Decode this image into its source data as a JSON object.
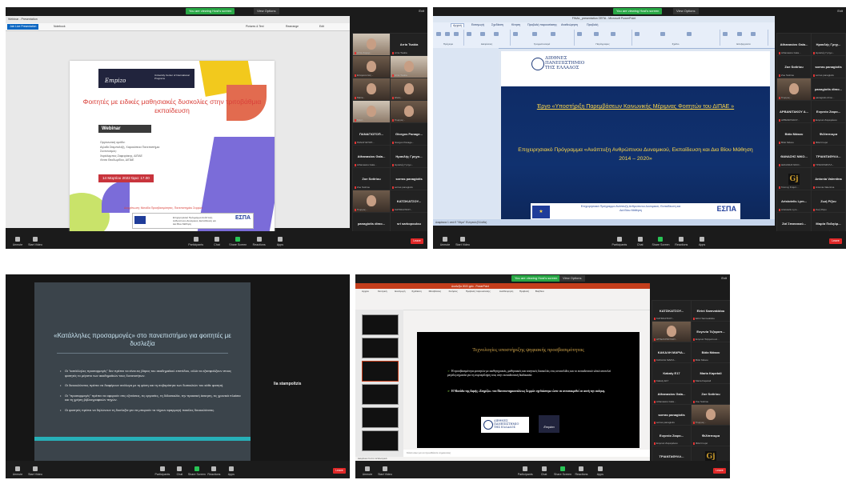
{
  "zoom": {
    "share_badge": "You are viewing Host's screen",
    "view_options": "View Options",
    "exit_label": "Exit",
    "controls": [
      "Unmute",
      "Start Video",
      "Participants",
      "Chat",
      "Share Screen",
      "Reactions",
      "Apps"
    ],
    "end_label": "Leave"
  },
  "panel1": {
    "browser_tab": "Webinar - Presentation",
    "toolbar": [
      "Join Live Presentation",
      "Notebook",
      "Pictures & Text",
      "Rearrange",
      "Edit"
    ],
    "slide": {
      "brand": "Empizo",
      "uni_text": "University Center of International Programs",
      "title": "Φοιτητές με ειδικές μαθησιακές δυσκολίες στην τριτοβάθμια εκπαίδευση",
      "webinar": "Webinar",
      "org_lines": [
        "Οργανωτική ομάδα:",
        "Αγλαΐα Σταμπολτζή, Χαροκόπειο Πανεπιστήμιο",
        "Συντονισμός:",
        "Χαράλαμπος Ζαφειράκης, ΔΙΠΑΕ",
        "Λίτσα Θεοδωρίδου, ΔΙΠΑΕ"
      ],
      "date": "14 Μαρτίου 2022  Ώρα: 17.00",
      "footer": "Διοργάνωση: Μονάδα Προσβασιμότητας, Πανεπιστημίου Σερρών",
      "espa_text": "Επιχειρησιακό Πρόγραμμα Ανάπτυξη Ανθρώπινου Δυναμικού, Εκπαίδευση και Δια Βίου Μάθηση",
      "espa": "ΕΣΠΑ"
    },
    "participants": [
      {
        "name": "",
        "sub": "Arria Ζαφειρ...",
        "photo": true
      },
      {
        "name": "Arria Tsakia",
        "sub": "Arria Tsakia",
        "photo": false
      },
      {
        "name": "",
        "sub": "Επαμινώντας...",
        "photo": true
      },
      {
        "name": "",
        "sub": "Arria Tsakia",
        "photo": true
      },
      {
        "name": "",
        "sub": "Maria...",
        "photo": true
      },
      {
        "name": "",
        "sub": "Ηλίας...",
        "photo": true
      },
      {
        "name": "",
        "sub": "Nikol...",
        "photo": true
      },
      {
        "name": "",
        "sub": "Γιώργος...",
        "photo": true
      },
      {
        "name": "ΠΑΝΑΓΙΩΤΟΠ...",
        "sub": "ΠΑΝΑΓΙΩΤΟΠ...",
        "photo": false
      },
      {
        "name": "Giorgos Panage...",
        "sub": "Giorgos Panage...",
        "photo": false
      },
      {
        "name": "Athanasios Gala...",
        "sub": "Athanasios Gala...",
        "photo": false
      },
      {
        "name": "Ηρακλής Γρηγο...",
        "sub": "Ηρακλής Γρηγο...",
        "photo": false
      },
      {
        "name": "Zoe Sotiriou",
        "sub": "Zoe Sotiriou",
        "photo": false
      },
      {
        "name": "sorras panagiotis",
        "sub": "sorras panagiotis",
        "photo": false
      },
      {
        "name": "",
        "sub": "Γιώργος...",
        "photo": true
      },
      {
        "name": "ΚΑΤΣΙΚΑΤΣΟΥ...",
        "sub": "ΚΑΤΣΙΚΑΤΣΟΥ...",
        "photo": false
      },
      {
        "name": "panagiotis dimo...",
        "sub": "panagiotis dimo...",
        "photo": false
      },
      {
        "name": "sri sarkopoulou",
        "sub": "sri sarkopoulou",
        "photo": false
      }
    ]
  },
  "panel2": {
    "window_title": "FINAL_presentation ΣΕΠΑ - Microsoft PowerPoint",
    "tabs": [
      "Αρχική",
      "Εισαγωγή",
      "Σχεδίαση",
      "Κίνηση",
      "Προβολή παρουσίασης",
      "Αναθεώρηση",
      "Προβολή"
    ],
    "groups": [
      "Πρόχειρο",
      "Διαφάνειες",
      "Γραμματοσειρά",
      "Παράγραφος",
      "Σχέδιο",
      "Επεξεργασία"
    ],
    "slide": {
      "logo": "ΔΙΕΘΝΕΣ\nΠΑΝΕΠΙΣΤΗΜΙΟ\nΤΗΣ ΕΛΛΑΔΟΣ",
      "project": "Έργο «Υποστήριξη Παρεμβάσεων Κοινωνικής Μέριμνας Φοιτητών του ΔΙΠΑΕ »",
      "programme": "Επιχειρησιακό Πρόγραμμα «Ανάπτυξη Ανθρώπινου Δυναμικού, Εκπαίδευση και Δια Βίου Μάθηση 2014 – 2020»",
      "espa_text": "Επιχειρησιακό Πρόγραμμα Ανάπτυξη Ανθρώπινου Δυναμικού, Εκπαίδευση και Διά Βίου Μάθηση",
      "espa": "ΕΣΠΑ"
    },
    "status": "Διαφάνεια 1 από 9   \"Θέμα\"   Ελληνικά (Ελλάδα)",
    "participants": [
      {
        "name": "Athanasios Gala...",
        "sub": "Athanasios Gala...",
        "photo": false
      },
      {
        "name": "Ηρακλής Γρηγ...",
        "sub": "Ηρακλής Γρηγο...",
        "photo": false
      },
      {
        "name": "Zoe Sotiriou",
        "sub": "Zoe Sotiriou",
        "photo": false
      },
      {
        "name": "sorras panagiotis",
        "sub": "sorras panagiotis",
        "photo": false
      },
      {
        "name": "",
        "sub": "Γιώργος...",
        "photo": true
      },
      {
        "name": "panagiotis dimo...",
        "sub": "panagiotis dimo...",
        "photo": false
      },
      {
        "name": "ΑΡΒΑΝΙΤΑΚΟΥ Α...",
        "sub": "ΑΡΒΑΝΙΤΑΚΟΥ...",
        "photo": false
      },
      {
        "name": "Ευγενία Ζαφει...",
        "sub": "Ευγενία Ζαφειράκου",
        "photo": false
      },
      {
        "name": "Βάϊα Μάκου",
        "sub": "Βάϊα Μάκου",
        "photo": false
      },
      {
        "name": "Φιλίππιορα",
        "sub": "Φιλίππιορα",
        "photo": false
      },
      {
        "name": "ΘΑΝΑΣΗΣ ΝΙΚΟ...",
        "sub": "ΘΑΝΑΣΗΣ ΝΙΚΟ...",
        "photo": false
      },
      {
        "name": "ΤΡΙΑΝΤΑΦΥΛΛ...",
        "sub": "ΤΡΙΑΝΤΑΦΥΛΛ...",
        "photo": false
      },
      {
        "name": "",
        "sub": "Γιάννης Σταμπ...",
        "logo": true
      },
      {
        "name": "Antonia Valentina",
        "sub": "Antonia Valentina",
        "photo": false
      },
      {
        "name": "Aristotelis Lym...",
        "sub": "Aristotelis Lym...",
        "photo": false
      },
      {
        "name": "Ζωή Ρίζου",
        "sub": "Ζωή Ρίζου",
        "photo": false
      },
      {
        "name": "Ζαϊ Σπανακού...",
        "sub": "Ζαϊ Σπανακούλ...",
        "photo": false
      },
      {
        "name": "Μαρία Παληόρ...",
        "sub": "Μαρία Παληόρ...",
        "photo": false
      }
    ]
  },
  "panel3": {
    "slide": {
      "title": "«Κατάλληλες προσαρμογές» στο πανεπιστήμιο για φοιτητές με δυσλεξία",
      "bullets": [
        "Οι \"κατάλληλες προσαρμογές\" δεν πρέπει να είναι εις βάρος του ακαδημαϊκού επιπέδου, αλλά να εξασφαλίζουν στους φοιτητές το μέγιστο των ακαδημαϊκών τους δυνατοτήτων.",
        "Οι διευκολύνσεις πρέπει να διαφέρουν ανάλογα με τη φύση και τη σοβαρότητα των δυσκολιών του κάθε φοιτητή.",
        "Οι \"προσαρμογές\" πρέπει να αφορούν στις εξετάσεις, τις εργασίες, τη διδασκαλία, την πρακτική άσκηση, τις χρονικά πλαίσια και τη χρήση βιβλιογραφικών πηγών.",
        "Οι φοιτητές πρέπει να δηλώνουν τη δυσλεξία για να μπορούν τα τύχουν εφαρμογή ποικίλες διευκολύνσεις."
      ]
    },
    "speaker": "lia stampoltzis"
  },
  "panel4": {
    "window_title": "Δυσλεξία 2022.pptx - PowerPoint",
    "tabs": [
      "Αρχείο",
      "Κεντρική",
      "Εισαγωγή",
      "Σχεδίαση",
      "Μεταβάσεις",
      "Κινήσεις",
      "Προβολή παρουσίασης",
      "Αναθεώρηση",
      "Προβολή",
      "Βοήθεια"
    ],
    "slide": {
      "title": "Τεχνολογίες υποστήριξης ψηφιακής προσβασιμότητας",
      "bullet1": "Η προσβασιμότητα φοιτητών με αισθητηριακές, μαθησιακές και κινητικές δυσκολίες στις ιστοσελίδες και το εκπαιδευτικό υλικό αποτελεί μεγάλη σημασία για τη συμπερίληψη τους στην εκπαιδευτική διαδικασία",
      "bullet2": "Η Μονάδα της Δομής «Στηρίζω» του Πανεπιστημιουπόλεως Σερρών σχεδιάστηκε ώστε να ανταποκριθεί σε αυτή την ανάγκη.",
      "logo1": "ΔΙΕΘΝΕΣ\nΠΑΝΕΠΙΣΤΗΜΙΟ\nΤΗΣ ΕΛΛΑΔΟΣ",
      "logo2": "Empizo"
    },
    "notes": "Κάντε κλικ για να προσθέσετε σημειώσεις",
    "status": "Διαφάνεια 6 από 12   Ελληνικά",
    "participants": [
      {
        "name": "ΚΑΤΣΙΚΑΤΣΟΥ...",
        "sub": "ΚΑΤΣΙΚΑΤΣΟΥ...",
        "photo": false
      },
      {
        "name": "Eirini Samvakidou",
        "sub": "Eirini Samvakidou",
        "photo": false
      },
      {
        "name": "",
        "sub": "ΑΓΓΕΛΟΠΟΥΛΟΥ...",
        "photo": true
      },
      {
        "name": "Ευγενία Τεζαροπ...",
        "sub": "Ευγενία Τεζαροπουλ...",
        "photo": false
      },
      {
        "name": "ΚΑΚΑΛΗ ΜΑΡΙΑ...",
        "sub": "ΚΑΚΑΛΗ ΜΑΡΙΑ...",
        "photo": false
      },
      {
        "name": "Βάϊα Μάκου",
        "sub": "Βάϊα Μάκου",
        "photo": false
      },
      {
        "name": "Kakaty E17",
        "sub": "Kakaty E17",
        "photo": false
      },
      {
        "name": "Maria Kapetali",
        "sub": "Maria Kapetali",
        "photo": false
      },
      {
        "name": "Athanasios Gala...",
        "sub": "Athanasios Gala...",
        "photo": false
      },
      {
        "name": "Zoe Sotiriou",
        "sub": "Zoe Sotiriou",
        "photo": false
      },
      {
        "name": "sorras panagiotis",
        "sub": "sorras panagiotis",
        "photo": false
      },
      {
        "name": "",
        "sub": "Γιώργος...",
        "photo": true
      },
      {
        "name": "Ευγενία Ζαφει...",
        "sub": "Ευγενία Ζαφειράκου",
        "photo": false
      },
      {
        "name": "Φιλίππιορα",
        "sub": "Φιλίππιορα",
        "photo": false
      },
      {
        "name": "ΤΡΙΑΝΤΑΦΥΛΛ...",
        "sub": "ΤΡΙΑΝΤΑΦΥΛΛ...",
        "photo": false
      },
      {
        "name": "",
        "sub": "Γιάννης Σταμπ...",
        "logo": true
      }
    ]
  }
}
